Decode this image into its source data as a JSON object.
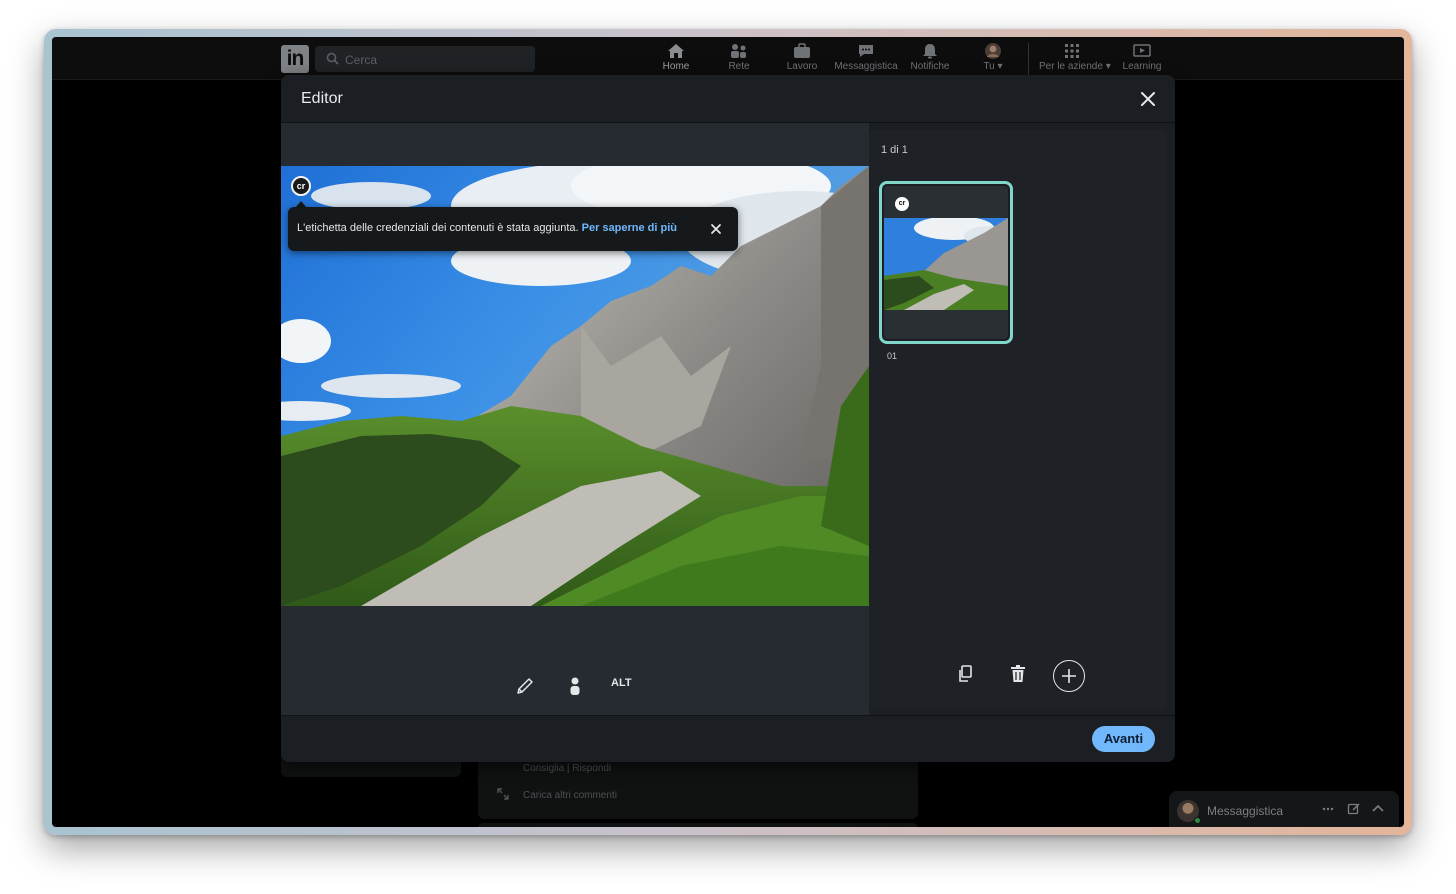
{
  "nav": {
    "search_placeholder": "Cerca",
    "items": [
      {
        "label": "Home",
        "icon": "home-icon"
      },
      {
        "label": "Rete",
        "icon": "network-icon"
      },
      {
        "label": "Lavoro",
        "icon": "briefcase-icon"
      },
      {
        "label": "Messaggistica",
        "icon": "chat-icon"
      },
      {
        "label": "Notifiche",
        "icon": "bell-icon"
      },
      {
        "label": "Tu ▾",
        "icon": "avatar"
      },
      {
        "label": "Per le aziende ▾",
        "icon": "grid-icon"
      },
      {
        "label": "Learning",
        "icon": "play-icon"
      }
    ]
  },
  "background": {
    "comment_actions": "Consiglia | Rispondi",
    "load_more_comments": "Carica altri commenti"
  },
  "messaging_bar": {
    "label": "Messaggistica"
  },
  "modal": {
    "title": "Editor",
    "tooltip": {
      "text": "L'etichetta delle credenziali dei contenuti è stata aggiunta.",
      "link": "Per saperne di più"
    },
    "cr_badge": "cr",
    "tools": {
      "edit_icon": "pencil-icon",
      "tag_icon": "person-icon",
      "alt_label": "ALT"
    },
    "side_panel": {
      "counter": "1 di 1",
      "thumbnail_index": "01"
    },
    "next_button": "Avanti"
  },
  "colors": {
    "accent": "#71b7fb",
    "thumbnail_border": "#7fd6c9",
    "modal_bg": "#1b1f23"
  }
}
